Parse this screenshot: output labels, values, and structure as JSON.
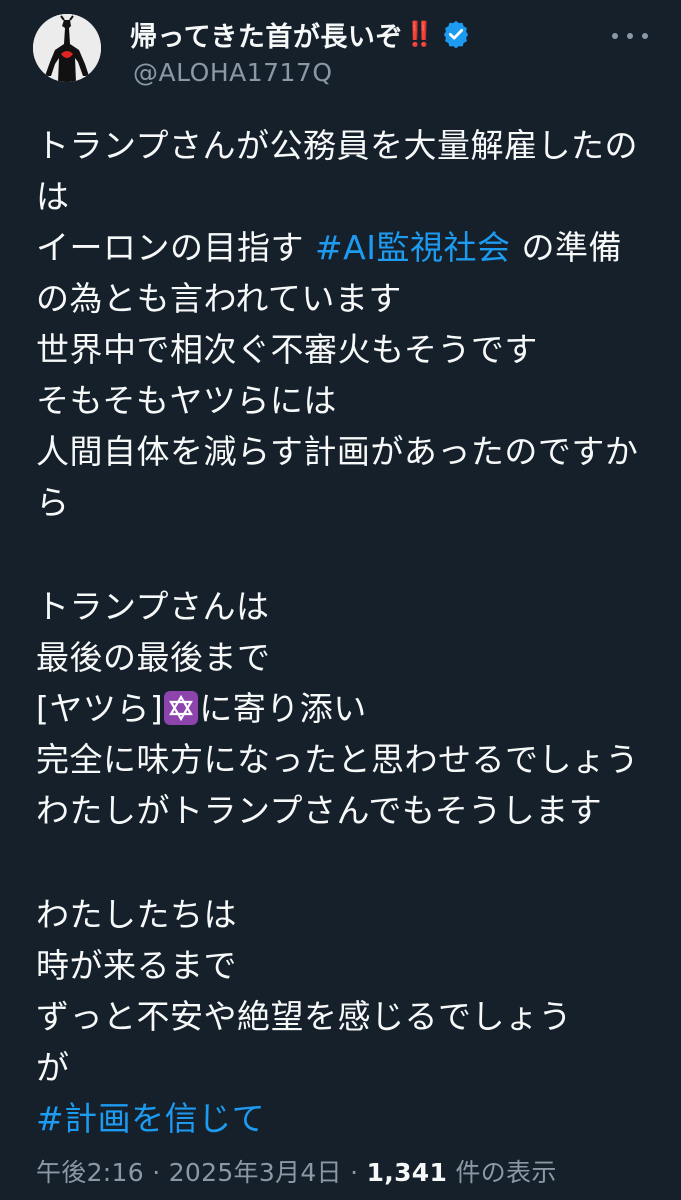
{
  "author": {
    "display_name": "帰ってきた首が長いぞ",
    "name_emoji": "‼️",
    "handle": "@ALOHA1717Q",
    "verified_icon": "verified-badge-icon",
    "avatar_icon": "avatar-silhouette"
  },
  "actions": {
    "more_icon": "more-dots-icon"
  },
  "tweet": {
    "lines": [
      "トランプさんが公務員を大量解雇したの",
      "は",
      "イーロンの目指す ",
      "#AI監視社会",
      " の準備",
      "の為とも言われています",
      "世界中で相次ぐ不審火もそうです",
      "そもそもヤツらには",
      "人間自体を減らす計画があったのですか",
      "ら",
      "",
      "トランプさんは",
      "最後の最後まで",
      "[ヤツら]",
      "に寄り添い",
      "完全に味方になったと思わせるでしょう",
      "わたしがトランプさんでもそうします",
      "",
      "わたしたちは",
      "時が来るまで",
      "ずっと不安や絶望を感じるでしょう",
      "が",
      "#計画を信じて"
    ],
    "emoji_star": "star-of-david-icon",
    "hashtag_color": "#1d9bf0"
  },
  "meta": {
    "time": "午後2:16",
    "sep1": " · ",
    "date": "2025年3月4日",
    "sep2": " · ",
    "views_count": "1,341",
    "views_label": " 件の表示"
  },
  "colors": {
    "background": "#15202b",
    "text": "#f7f9f9",
    "secondary": "#8b98a5",
    "accent": "#1d9bf0"
  }
}
